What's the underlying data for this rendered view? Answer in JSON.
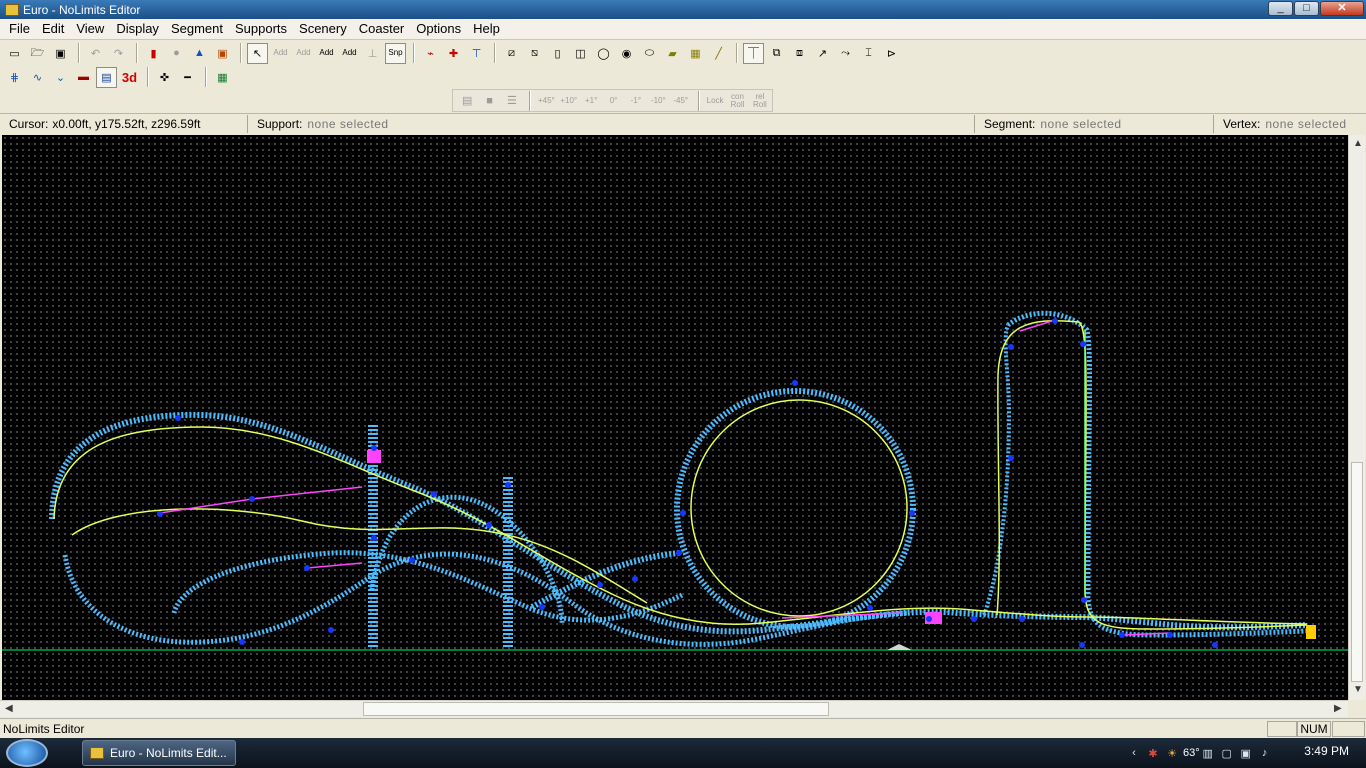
{
  "window": {
    "title": "Euro - NoLimits Editor",
    "buttons": [
      "_",
      "□",
      "✕"
    ]
  },
  "menu": [
    "File",
    "Edit",
    "View",
    "Display",
    "Segment",
    "Supports",
    "Scenery",
    "Coaster",
    "Options",
    "Help"
  ],
  "toolbar": {
    "snap_label": "Snp",
    "add_labels": [
      "Add",
      "Add",
      "Add",
      "Add"
    ],
    "three_d_label": "3d"
  },
  "roll_toolbar": {
    "labels": [
      "+45°",
      "+10°",
      "+1°",
      "0°",
      "-1°",
      "-10°",
      "-45°"
    ],
    "lock_roll": "Lock",
    "con_roll": "con Roll",
    "rel_roll": "rel Roll"
  },
  "statusinfo": {
    "cursor_label": "Cursor:",
    "cursor_value": "x0.00ft, y175.52ft, z296.59ft",
    "support_label": "Support:",
    "support_value": "none selected",
    "segment_label": "Segment:",
    "segment_value": "none selected",
    "vertex_label": "Vertex:",
    "vertex_value": "none selected"
  },
  "statusbar": {
    "text": "NoLimits Editor",
    "num": "NUM"
  },
  "taskbar": {
    "task_label": "Euro - NoLimits Edit...",
    "temperature": "63°",
    "time": "3:49 PM"
  },
  "colors": {
    "track": "#4cbcff",
    "spine": "#e3ff5a",
    "ground": "#00ff66",
    "selected": "#ff44ff",
    "node": "#1737ff"
  }
}
